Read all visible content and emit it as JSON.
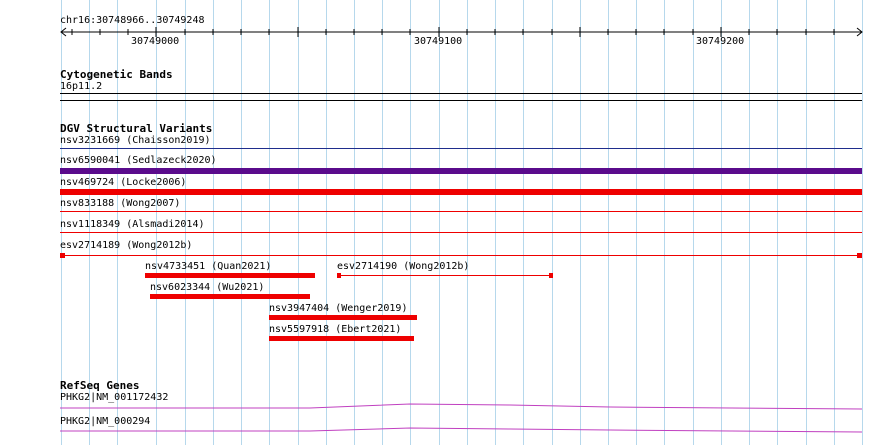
{
  "ruler": {
    "location": "chr16:30748966..30749248",
    "ticks": [
      "30749000",
      "30749100",
      "30749200"
    ]
  },
  "cytoband": {
    "title": "Cytogenetic Bands",
    "band": "16p11.2"
  },
  "dgv": {
    "title": "DGV Structural Variants",
    "variants": [
      "nsv3231669 (Chaisson2019)",
      "nsv6590041 (Sedlazeck2020)",
      "nsv469724 (Locke2006)",
      "nsv833188 (Wong2007)",
      "nsv1118349 (Alsmadi2014)",
      "esv2714189 (Wong2012b)",
      "nsv4733451 (Quan2021)",
      "esv2714190 (Wong2012b)",
      "nsv6023344 (Wu2021)",
      "nsv3947404 (Wenger2019)",
      "nsv5597918 (Ebert2021)"
    ]
  },
  "refseq": {
    "title": "RefSeq Genes",
    "genes": [
      "PHKG2|NM_001172432",
      "PHKG2|NM_000294"
    ]
  },
  "colors": {
    "grid": "#b6d8ec",
    "variant_blue": "#1f2d8c",
    "variant_purple": "#5a0b8c",
    "variant_red": "#ee0000",
    "gene_magenta": "#c040c0"
  }
}
